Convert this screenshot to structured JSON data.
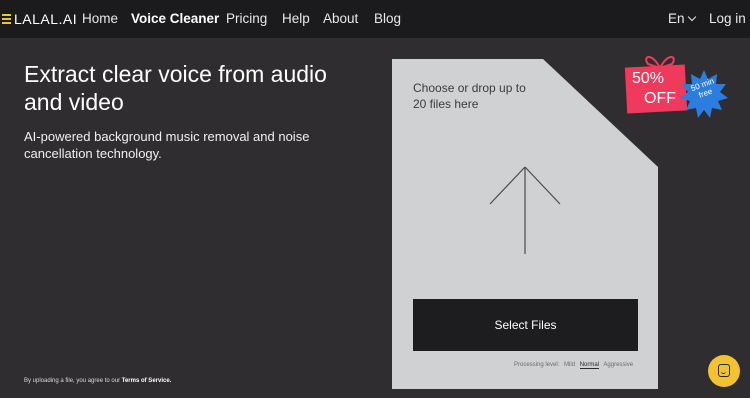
{
  "brand": {
    "name": "LALAL.AI"
  },
  "nav": {
    "items": [
      {
        "label": "Home"
      },
      {
        "label": "Voice Cleaner"
      },
      {
        "label": "Pricing"
      },
      {
        "label": "Help"
      },
      {
        "label": "About"
      },
      {
        "label": "Blog"
      }
    ],
    "language": "En",
    "login": "Log in"
  },
  "hero": {
    "title": "Extract clear voice from audio and video",
    "subtitle": "AI-powered background music removal and noise cancellation technology."
  },
  "legal": {
    "prefix": "By uploading a file, you agree to our",
    "link": "Terms of Service."
  },
  "upload": {
    "prompt": "Choose or drop up to 20 files here",
    "button": "Select Files",
    "processing_label": "Processing level:",
    "levels": [
      "Mild",
      "Normal",
      "Aggressive"
    ],
    "selected_level": "Normal"
  },
  "promo": {
    "discount": "50%",
    "off": "OFF",
    "bonus": "50 min free"
  },
  "colors": {
    "accent": "#f2c230",
    "promo": "#ef3a5d",
    "burst": "#2c7de0",
    "background": "#2f2d2f",
    "nav": "#1b1a1c"
  }
}
